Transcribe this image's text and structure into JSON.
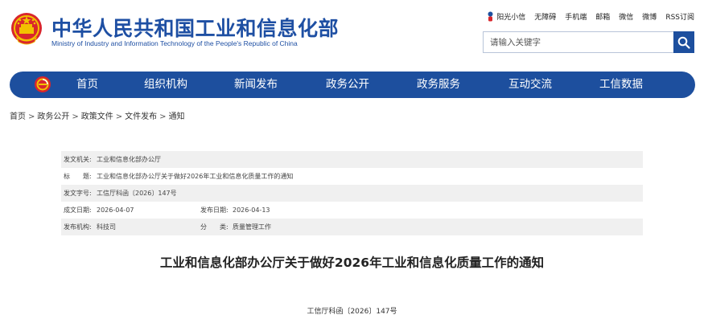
{
  "header": {
    "title": "中华人民共和国工业和信息化部",
    "subtitle": "Ministry of Industry and Information Technology of the People's Republic of China",
    "top_links": [
      "阳光小信",
      "无障碍",
      "手机端",
      "邮箱",
      "微信",
      "微博",
      "RSS订阅"
    ],
    "search_placeholder": "请输入关键字",
    "brand_color": "#1d4f9e"
  },
  "nav": {
    "items": [
      "首页",
      "组织机构",
      "新闻发布",
      "政务公开",
      "政务服务",
      "互动交流",
      "工信数据"
    ]
  },
  "breadcrumb": [
    "首页",
    "政务公开",
    "政策文件",
    "文件发布",
    "通知"
  ],
  "breadcrumb_separator": ">",
  "info": {
    "issuer_label": "发文机关:",
    "issuer": "工业和信息化部办公厅",
    "title_label": "标　　题:",
    "title": "工业和信息化部办公厅关于做好2026年工业和信息化质量工作的通知",
    "doc_no_label": "发文字号:",
    "doc_no": "工信厅科函〔2026〕147号",
    "written_label": "成文日期:",
    "written": "2026-04-07",
    "published_label": "发布日期:",
    "published": "2026-04-13",
    "org_label": "发布机构:",
    "org": "科技司",
    "category_label": "分　　类:",
    "category": "质量管理工作"
  },
  "article": {
    "title": "工业和信息化部办公厅关于做好2026年工业和信息化质量工作的通知",
    "doc_number": "工信厅科函〔2026〕147号"
  }
}
